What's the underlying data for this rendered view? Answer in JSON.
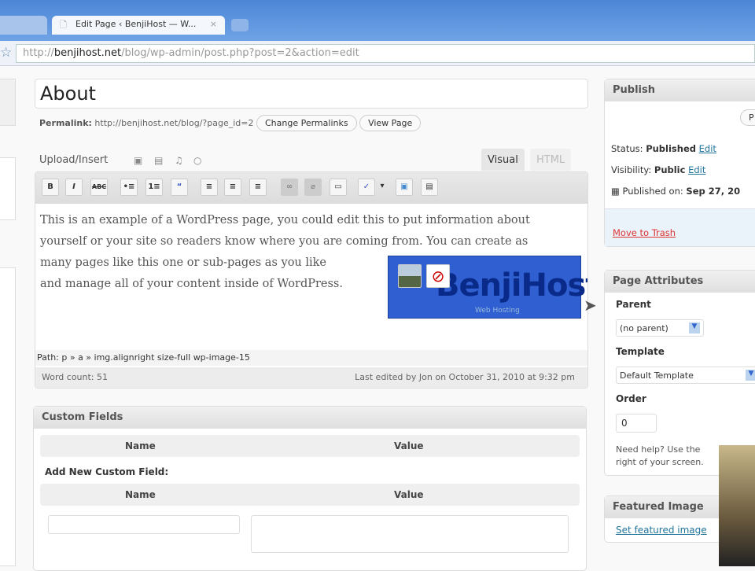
{
  "browser": {
    "tab_title": "Edit Page ‹ BenjiHost — W...",
    "url_prefix": "http://",
    "url_domain": "benjihost.net",
    "url_path": "/blog/wp-admin/post.php?post=2&action=edit"
  },
  "post": {
    "title": "About",
    "permalink_label": "Permalink:",
    "permalink_url": "http://benjihost.net/blog/?page_id=2",
    "change_permalinks": "Change Permalinks",
    "view_page": "View Page"
  },
  "editor": {
    "upload_insert": "Upload/Insert",
    "tab_visual": "Visual",
    "tab_html": "HTML",
    "toolbar": [
      "B",
      "I",
      "ABC",
      "•≡",
      "1≡",
      "“",
      "≡",
      "≡",
      "≡",
      "∞",
      "⌀",
      "▭",
      "✓",
      "▾",
      "▣",
      "▤"
    ],
    "content_lines": [
      "This is an example of a WordPress page, you could edit this to put information about",
      "yourself or your site so readers know where you are coming from. You can create as",
      "many pages like this one or sub-pages as you like",
      "and manage all of your content inside of WordPress."
    ],
    "image_text": "BenjiHost",
    "image_subtext": "Web Hosting",
    "path": "Path: p » a » img.alignright size-full wp-image-15",
    "word_count": "Word count: 51",
    "last_edited": "Last edited by Jon on October 31, 2010 at 9:32 pm"
  },
  "custom_fields": {
    "title": "Custom Fields",
    "name_header": "Name",
    "value_header": "Value",
    "add_new": "Add New Custom Field:"
  },
  "publish": {
    "title": "Publish",
    "preview_button": "P",
    "status_label": "Status:",
    "status_value": "Published",
    "visibility_label": "Visibility:",
    "visibility_value": "Public",
    "edit": "Edit",
    "published_on_label": "Published on:",
    "published_on_value": "Sep 27, 20",
    "trash": "Move to Trash"
  },
  "page_attributes": {
    "title": "Page Attributes",
    "parent_label": "Parent",
    "parent_value": "(no parent)",
    "template_label": "Template",
    "template_value": "Default Template",
    "order_label": "Order",
    "order_value": "0",
    "help_line1": "Need help? Use the",
    "help_line2": "right of your screen."
  },
  "featured_image": {
    "title": "Featured Image",
    "link": "Set featured image"
  }
}
